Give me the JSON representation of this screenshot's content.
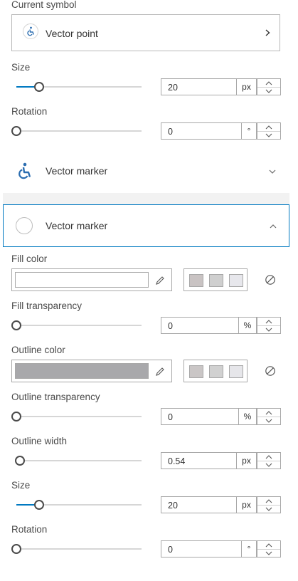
{
  "current_symbol": {
    "label": "Current symbol",
    "name": "Vector point",
    "icon": "wheelchair-icon",
    "chevron": "chevron-right-icon"
  },
  "top_size": {
    "label": "Size",
    "value": "20",
    "unit": "px",
    "level": 0.18
  },
  "top_rotation": {
    "label": "Rotation",
    "value": "0",
    "unit": "°",
    "level": 0
  },
  "layer_marker": {
    "title": "Vector marker",
    "icon": "wheelchair-icon",
    "chevron": "chevron-down-icon"
  },
  "circle_marker": {
    "title": "Vector marker",
    "icon": "circle-icon",
    "chevron": "chevron-up-icon"
  },
  "fill_color": {
    "label": "Fill color",
    "current": "#ffffff",
    "recent": [
      "#c9c3c3",
      "#cfcfcf",
      "#e7e7ec"
    ]
  },
  "fill_transparency": {
    "label": "Fill transparency",
    "value": "0",
    "unit": "%",
    "level": 0
  },
  "outline_color": {
    "label": "Outline color",
    "current": "#a8a8ab",
    "recent": [
      "#cac6c6",
      "#d1d1d1",
      "#e6e6ea"
    ]
  },
  "outline_transparency": {
    "label": "Outline transparency",
    "value": "0",
    "unit": "%",
    "level": 0
  },
  "outline_width": {
    "label": "Outline width",
    "value": "0.54",
    "unit": "px",
    "level": 0.03
  },
  "bottom_size": {
    "label": "Size",
    "value": "20",
    "unit": "px",
    "level": 0.18
  },
  "bottom_rotation": {
    "label": "Rotation",
    "value": "0",
    "unit": "°",
    "level": 0
  },
  "colors": {
    "accent": "#0079c1",
    "thumb_border": "#4a4a4a",
    "icon_blue": "#2b6db0"
  }
}
